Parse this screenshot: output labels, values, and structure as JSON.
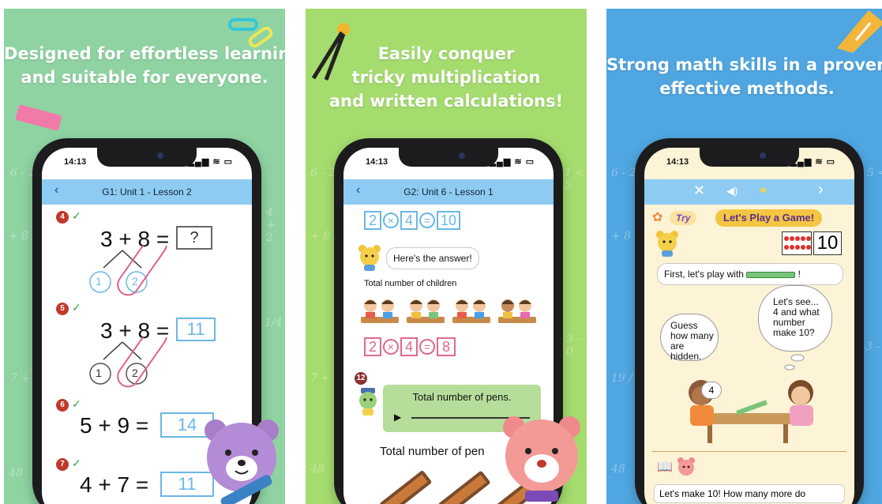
{
  "colors": {
    "panel1_bg": "#8fd3a2",
    "panel2_bg": "#a5dc6e",
    "panel3_bg": "#4fa6e0",
    "nav_bar": "#8ecbf2",
    "answer_box": "#6ab7e6",
    "badge_red": "#c0392b",
    "check_green": "#2ea44f",
    "game_banner": "#f4c542"
  },
  "panels": [
    {
      "headline": [
        "Designed for effortless learning",
        "and suitable for everyone."
      ],
      "status_time": "14:13",
      "nav_title": "G1: Unit 1 - Lesson 2",
      "problems": [
        {
          "num": "4",
          "eq": "3 + 8 =",
          "answer": "?",
          "bonds": [
            "1",
            "2"
          ]
        },
        {
          "num": "5",
          "eq": "3 + 8 =",
          "answer": "11",
          "bonds": [
            "1",
            "2"
          ]
        },
        {
          "num": "6",
          "eq": "5 + 9 =",
          "answer": "14"
        },
        {
          "num": "7",
          "eq": "4 + 7 =",
          "answer": "11"
        }
      ]
    },
    {
      "headline": [
        "Easily conquer",
        "tricky multiplication",
        "and written calculations!"
      ],
      "status_time": "14:13",
      "nav_title": "G2: Unit 6 - Lesson 1",
      "top_eq": [
        "2",
        "×",
        "4",
        "=",
        "10"
      ],
      "speech": "Here's the answer!",
      "children_label": "Total number of children",
      "mid_eq": [
        "2",
        "×",
        "4",
        "=",
        "8"
      ],
      "problem_num": "12",
      "pens_bubble": "Total number of pens.",
      "pens_label": "Total number of pen"
    },
    {
      "headline": [
        "Strong math skills in a proven",
        "effective methods."
      ],
      "status_time": "14:13",
      "try_label": "Try",
      "game_title": "Let's Play a Game!",
      "counter_value": "10",
      "first_line": "First, let's play with",
      "first_line_end": "!",
      "guess_bubble": [
        "Guess",
        "how many",
        "are hidden."
      ],
      "lets_see_bubble": [
        "Let's see...",
        "4 and what",
        "number",
        "make 10?"
      ],
      "hand_card": "4",
      "bottom_text": "Let's make 10! How many more do"
    }
  ]
}
